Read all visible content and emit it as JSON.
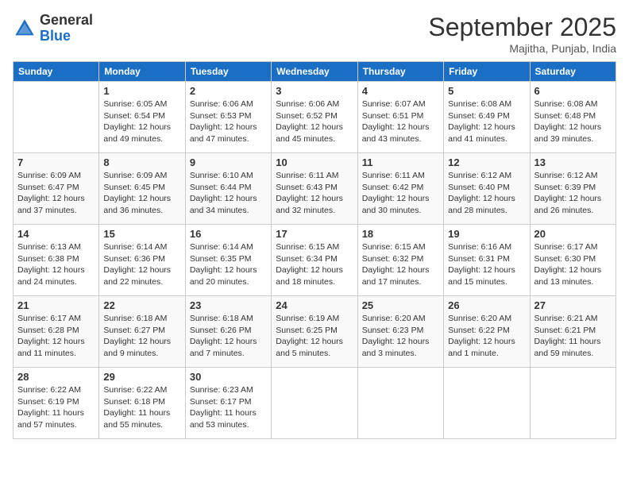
{
  "header": {
    "logo_general": "General",
    "logo_blue": "Blue",
    "month_title": "September 2025",
    "location": "Majitha, Punjab, India"
  },
  "days_of_week": [
    "Sunday",
    "Monday",
    "Tuesday",
    "Wednesday",
    "Thursday",
    "Friday",
    "Saturday"
  ],
  "weeks": [
    [
      {
        "day": "",
        "sunrise": "",
        "sunset": "",
        "daylight": ""
      },
      {
        "day": "1",
        "sunrise": "Sunrise: 6:05 AM",
        "sunset": "Sunset: 6:54 PM",
        "daylight": "Daylight: 12 hours and 49 minutes."
      },
      {
        "day": "2",
        "sunrise": "Sunrise: 6:06 AM",
        "sunset": "Sunset: 6:53 PM",
        "daylight": "Daylight: 12 hours and 47 minutes."
      },
      {
        "day": "3",
        "sunrise": "Sunrise: 6:06 AM",
        "sunset": "Sunset: 6:52 PM",
        "daylight": "Daylight: 12 hours and 45 minutes."
      },
      {
        "day": "4",
        "sunrise": "Sunrise: 6:07 AM",
        "sunset": "Sunset: 6:51 PM",
        "daylight": "Daylight: 12 hours and 43 minutes."
      },
      {
        "day": "5",
        "sunrise": "Sunrise: 6:08 AM",
        "sunset": "Sunset: 6:49 PM",
        "daylight": "Daylight: 12 hours and 41 minutes."
      },
      {
        "day": "6",
        "sunrise": "Sunrise: 6:08 AM",
        "sunset": "Sunset: 6:48 PM",
        "daylight": "Daylight: 12 hours and 39 minutes."
      }
    ],
    [
      {
        "day": "7",
        "sunrise": "Sunrise: 6:09 AM",
        "sunset": "Sunset: 6:47 PM",
        "daylight": "Daylight: 12 hours and 37 minutes."
      },
      {
        "day": "8",
        "sunrise": "Sunrise: 6:09 AM",
        "sunset": "Sunset: 6:45 PM",
        "daylight": "Daylight: 12 hours and 36 minutes."
      },
      {
        "day": "9",
        "sunrise": "Sunrise: 6:10 AM",
        "sunset": "Sunset: 6:44 PM",
        "daylight": "Daylight: 12 hours and 34 minutes."
      },
      {
        "day": "10",
        "sunrise": "Sunrise: 6:11 AM",
        "sunset": "Sunset: 6:43 PM",
        "daylight": "Daylight: 12 hours and 32 minutes."
      },
      {
        "day": "11",
        "sunrise": "Sunrise: 6:11 AM",
        "sunset": "Sunset: 6:42 PM",
        "daylight": "Daylight: 12 hours and 30 minutes."
      },
      {
        "day": "12",
        "sunrise": "Sunrise: 6:12 AM",
        "sunset": "Sunset: 6:40 PM",
        "daylight": "Daylight: 12 hours and 28 minutes."
      },
      {
        "day": "13",
        "sunrise": "Sunrise: 6:12 AM",
        "sunset": "Sunset: 6:39 PM",
        "daylight": "Daylight: 12 hours and 26 minutes."
      }
    ],
    [
      {
        "day": "14",
        "sunrise": "Sunrise: 6:13 AM",
        "sunset": "Sunset: 6:38 PM",
        "daylight": "Daylight: 12 hours and 24 minutes."
      },
      {
        "day": "15",
        "sunrise": "Sunrise: 6:14 AM",
        "sunset": "Sunset: 6:36 PM",
        "daylight": "Daylight: 12 hours and 22 minutes."
      },
      {
        "day": "16",
        "sunrise": "Sunrise: 6:14 AM",
        "sunset": "Sunset: 6:35 PM",
        "daylight": "Daylight: 12 hours and 20 minutes."
      },
      {
        "day": "17",
        "sunrise": "Sunrise: 6:15 AM",
        "sunset": "Sunset: 6:34 PM",
        "daylight": "Daylight: 12 hours and 18 minutes."
      },
      {
        "day": "18",
        "sunrise": "Sunrise: 6:15 AM",
        "sunset": "Sunset: 6:32 PM",
        "daylight": "Daylight: 12 hours and 17 minutes."
      },
      {
        "day": "19",
        "sunrise": "Sunrise: 6:16 AM",
        "sunset": "Sunset: 6:31 PM",
        "daylight": "Daylight: 12 hours and 15 minutes."
      },
      {
        "day": "20",
        "sunrise": "Sunrise: 6:17 AM",
        "sunset": "Sunset: 6:30 PM",
        "daylight": "Daylight: 12 hours and 13 minutes."
      }
    ],
    [
      {
        "day": "21",
        "sunrise": "Sunrise: 6:17 AM",
        "sunset": "Sunset: 6:28 PM",
        "daylight": "Daylight: 12 hours and 11 minutes."
      },
      {
        "day": "22",
        "sunrise": "Sunrise: 6:18 AM",
        "sunset": "Sunset: 6:27 PM",
        "daylight": "Daylight: 12 hours and 9 minutes."
      },
      {
        "day": "23",
        "sunrise": "Sunrise: 6:18 AM",
        "sunset": "Sunset: 6:26 PM",
        "daylight": "Daylight: 12 hours and 7 minutes."
      },
      {
        "day": "24",
        "sunrise": "Sunrise: 6:19 AM",
        "sunset": "Sunset: 6:25 PM",
        "daylight": "Daylight: 12 hours and 5 minutes."
      },
      {
        "day": "25",
        "sunrise": "Sunrise: 6:20 AM",
        "sunset": "Sunset: 6:23 PM",
        "daylight": "Daylight: 12 hours and 3 minutes."
      },
      {
        "day": "26",
        "sunrise": "Sunrise: 6:20 AM",
        "sunset": "Sunset: 6:22 PM",
        "daylight": "Daylight: 12 hours and 1 minute."
      },
      {
        "day": "27",
        "sunrise": "Sunrise: 6:21 AM",
        "sunset": "Sunset: 6:21 PM",
        "daylight": "Daylight: 11 hours and 59 minutes."
      }
    ],
    [
      {
        "day": "28",
        "sunrise": "Sunrise: 6:22 AM",
        "sunset": "Sunset: 6:19 PM",
        "daylight": "Daylight: 11 hours and 57 minutes."
      },
      {
        "day": "29",
        "sunrise": "Sunrise: 6:22 AM",
        "sunset": "Sunset: 6:18 PM",
        "daylight": "Daylight: 11 hours and 55 minutes."
      },
      {
        "day": "30",
        "sunrise": "Sunrise: 6:23 AM",
        "sunset": "Sunset: 6:17 PM",
        "daylight": "Daylight: 11 hours and 53 minutes."
      },
      {
        "day": "",
        "sunrise": "",
        "sunset": "",
        "daylight": ""
      },
      {
        "day": "",
        "sunrise": "",
        "sunset": "",
        "daylight": ""
      },
      {
        "day": "",
        "sunrise": "",
        "sunset": "",
        "daylight": ""
      },
      {
        "day": "",
        "sunrise": "",
        "sunset": "",
        "daylight": ""
      }
    ]
  ]
}
